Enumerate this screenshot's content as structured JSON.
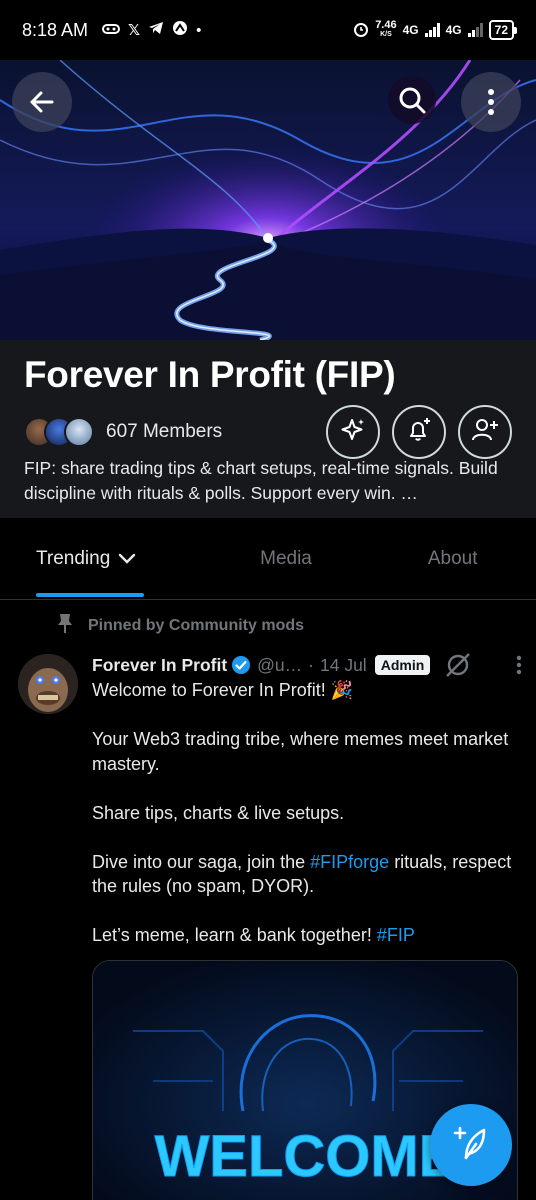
{
  "status_bar": {
    "time": "8:18 AM",
    "net_speed": "7.46",
    "net_unit": "K/S",
    "network_1": "4G",
    "network_2": "4G",
    "battery": "72"
  },
  "banner": {
    "back_icon": "arrow-left-icon",
    "search_icon": "search-icon",
    "more_icon": "more-vertical-icon"
  },
  "community": {
    "title": "Forever In Profit (FIP)",
    "members": "607 Members",
    "description": "FIP: share trading tips & chart setups, real-time signals. Build discipline with rituals & polls. Support every win. …"
  },
  "tabs": [
    {
      "label": "Trending",
      "active": true
    },
    {
      "label": "Media",
      "active": false
    },
    {
      "label": "About",
      "active": false
    }
  ],
  "post": {
    "pinned_label": "Pinned by Community mods",
    "author": "Forever In Profit",
    "handle": "@u…",
    "separator": "·",
    "date": "14 Jul",
    "badge": "Admin",
    "line1": "Welcome to Forever In Profit! 🎉",
    "line2": "Your Web3 trading tribe, where memes meet market mastery.",
    "line3": "Share tips, charts & live setups.",
    "line4_pre": "Dive into our saga, join the ",
    "line4_tag": "#FIPforge",
    "line4_post": " rituals, respect the rules (no spam, DYOR).",
    "line5_pre": "Let’s meme, learn & bank together! ",
    "line5_tag": "#FIP",
    "media_text": "WELCOME"
  },
  "colors": {
    "accent": "#1d9bf0",
    "header_bg": "#16181c",
    "muted": "#71767b"
  }
}
